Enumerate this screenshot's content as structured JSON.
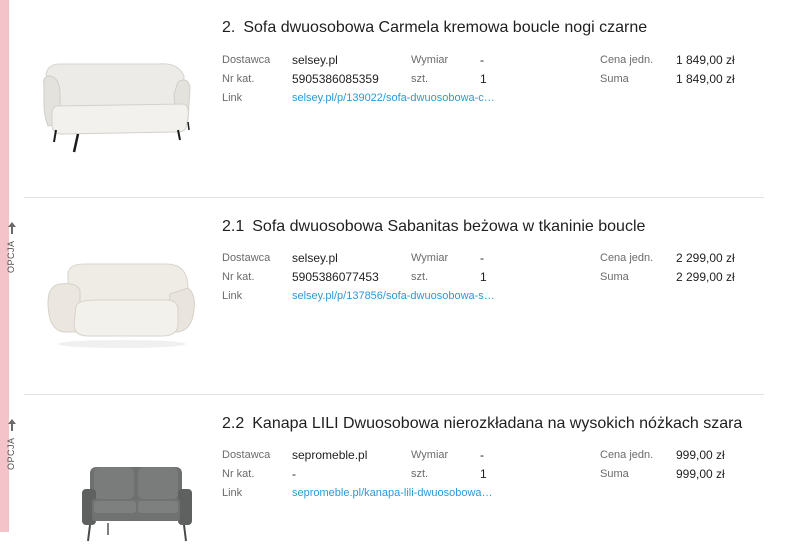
{
  "labels": {
    "supplier": "Dostawca",
    "catalog": "Nr kat.",
    "link": "Link",
    "dimension": "Wymiar",
    "qty": "szt.",
    "unit_price": "Cena jedn.",
    "total": "Suma",
    "option": "OPCJA"
  },
  "products": [
    {
      "number": "2.",
      "title": "Sofa dwuosobowa Carmela kremowa boucle nogi czarne",
      "supplier": "selsey.pl",
      "catalog": "5905386085359",
      "link": "selsey.pl/p/139022/sofa-dwuosobowa-c…",
      "dimension": "-",
      "qty": "1",
      "unit_price": "1 849,00 zł",
      "total": "1 849,00 zł"
    },
    {
      "number": "2.1",
      "title": "Sofa dwuosobowa Sabanitas beżowa w tkaninie boucle",
      "supplier": "selsey.pl",
      "catalog": "5905386077453",
      "link": "selsey.pl/p/137856/sofa-dwuosobowa-s…",
      "dimension": "-",
      "qty": "1",
      "unit_price": "2 299,00 zł",
      "total": "2 299,00 zł"
    },
    {
      "number": "2.2",
      "title": "Kanapa LILI Dwuosobowa nierozkładana na wysokich nóżkach szara",
      "supplier": "sepromeble.pl",
      "catalog": "-",
      "link": "sepromeble.pl/kanapa-lili-dwuosobowa…",
      "dimension": "-",
      "qty": "1",
      "unit_price": "999,00 zł",
      "total": "999,00 zł"
    }
  ],
  "colors": {
    "accent_stripe": "#f4c3c9",
    "link": "#2a9ad8"
  }
}
